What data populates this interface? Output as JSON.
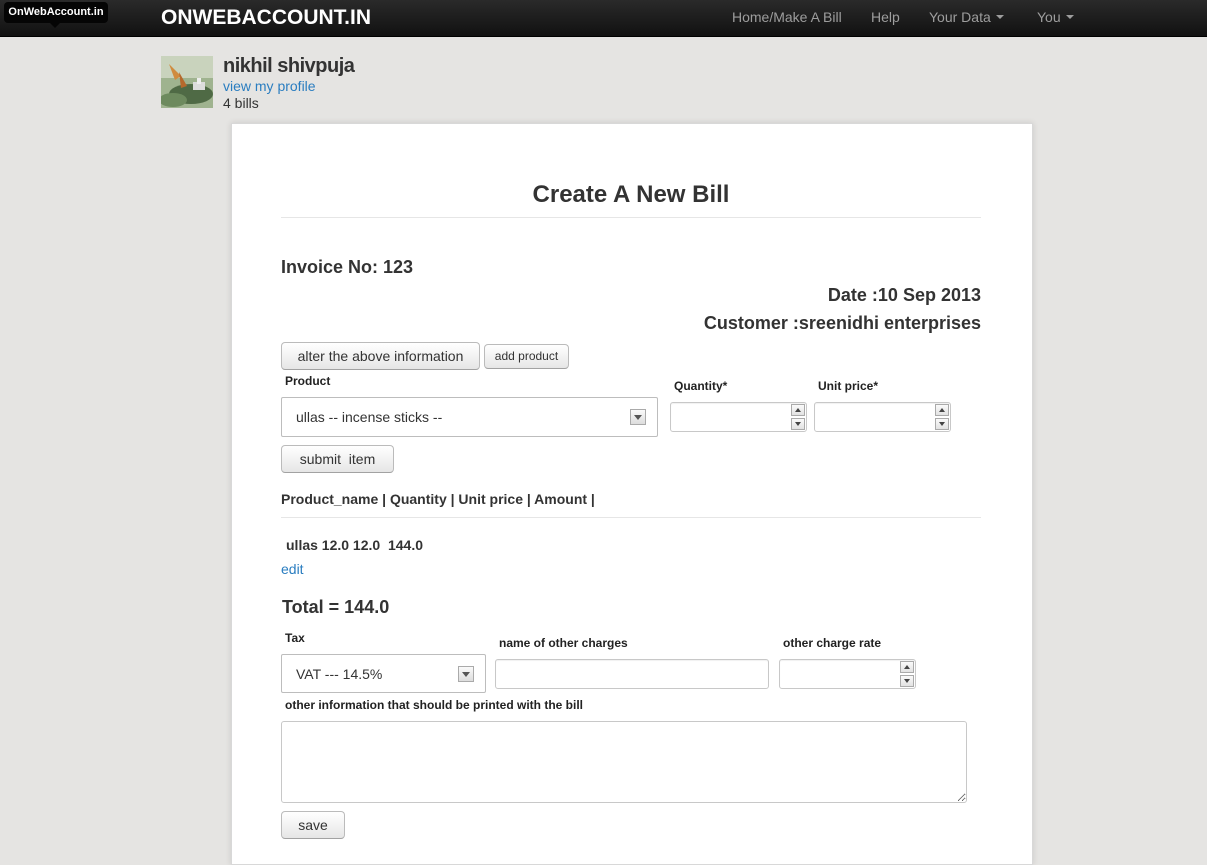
{
  "tooltip": {
    "text": "OnWebAccount.in"
  },
  "navbar": {
    "brand": "ONWEBACCOUNT.IN",
    "links": [
      {
        "label": "Home/Make A Bill"
      },
      {
        "label": "Help"
      },
      {
        "label": "Your Data",
        "dropdown": true
      },
      {
        "label": "You",
        "dropdown": true
      }
    ]
  },
  "profile": {
    "name": "nikhil shivpuja",
    "link": "view my profile",
    "bill_count": "4 bills"
  },
  "bill": {
    "title": "Create A New Bill",
    "invoice": "Invoice No: 123",
    "date": "Date :10 Sep 2013",
    "customer": "Customer :sreenidhi enterprises",
    "alter_button": "alter the above information",
    "add_product_button": "add product",
    "product_label": "Product",
    "product_value": "ullas -- incense sticks --",
    "quantity_label": "Quantity*",
    "unit_price_label": "Unit price*",
    "quantity_value": "",
    "unit_price_value": "",
    "submit_button": "submit  item",
    "table_header": "Product_name | Quantity | Unit price | Amount |",
    "items": [
      {
        "text": "ullas 12.0 12.0  144.0"
      }
    ],
    "edit_link": "edit",
    "total": "Total = 144.0",
    "tax_label": "Tax",
    "tax_value": "VAT --- 14.5%",
    "other_charges_label": "name of other charges",
    "other_charge_rate_label": "other charge rate",
    "other_info_label": "other information that should be printed with the bill",
    "save_button": "save"
  },
  "colors": {
    "navbar": "#1b1b1b",
    "background": "#e5e4e2",
    "link": "#2a7dc0"
  }
}
